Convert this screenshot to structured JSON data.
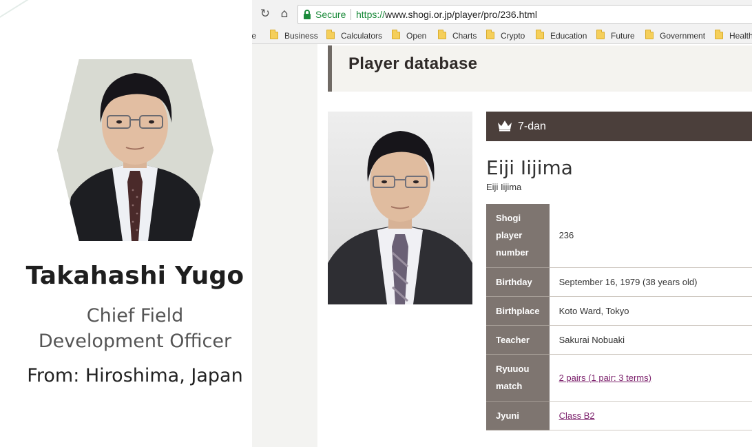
{
  "profile": {
    "name": "Takahashi Yugo",
    "role_line1": "Chief Field",
    "role_line2": "Development Officer",
    "from": "From: Hiroshima, Japan"
  },
  "browser": {
    "secure_label": "Secure",
    "url_scheme": "https://",
    "url_rest": "www.shogi.or.jp/player/pro/236.html",
    "bookmarks": [
      "ile",
      "Business",
      "Calculators",
      "Open",
      "Charts",
      "Crypto",
      "Education",
      "Future",
      "Government",
      "Health"
    ]
  },
  "page": {
    "section_title": "Player database",
    "rank": "7-dan",
    "player_name": "Eiji Iijima",
    "player_name_sub": "Eiji Iijima",
    "table": [
      {
        "label": "Shogi player number",
        "value": "236"
      },
      {
        "label": "Birthday",
        "value": "September 16, 1979 (38 years old)"
      },
      {
        "label": "Birthplace",
        "value": "Koto Ward, Tokyo"
      },
      {
        "label": "Teacher",
        "value": "Sakurai Nobuaki"
      },
      {
        "label": "Ryuuou match",
        "value": "2 pairs (1 pair: 3 terms)"
      },
      {
        "label": "Jyuni",
        "value": "Class B2"
      }
    ]
  },
  "colors": {
    "rank_bar": "#4b3f3b",
    "table_header": "#7e7570",
    "link": "#7a1e6a",
    "secure_green": "#1a8a3a"
  }
}
